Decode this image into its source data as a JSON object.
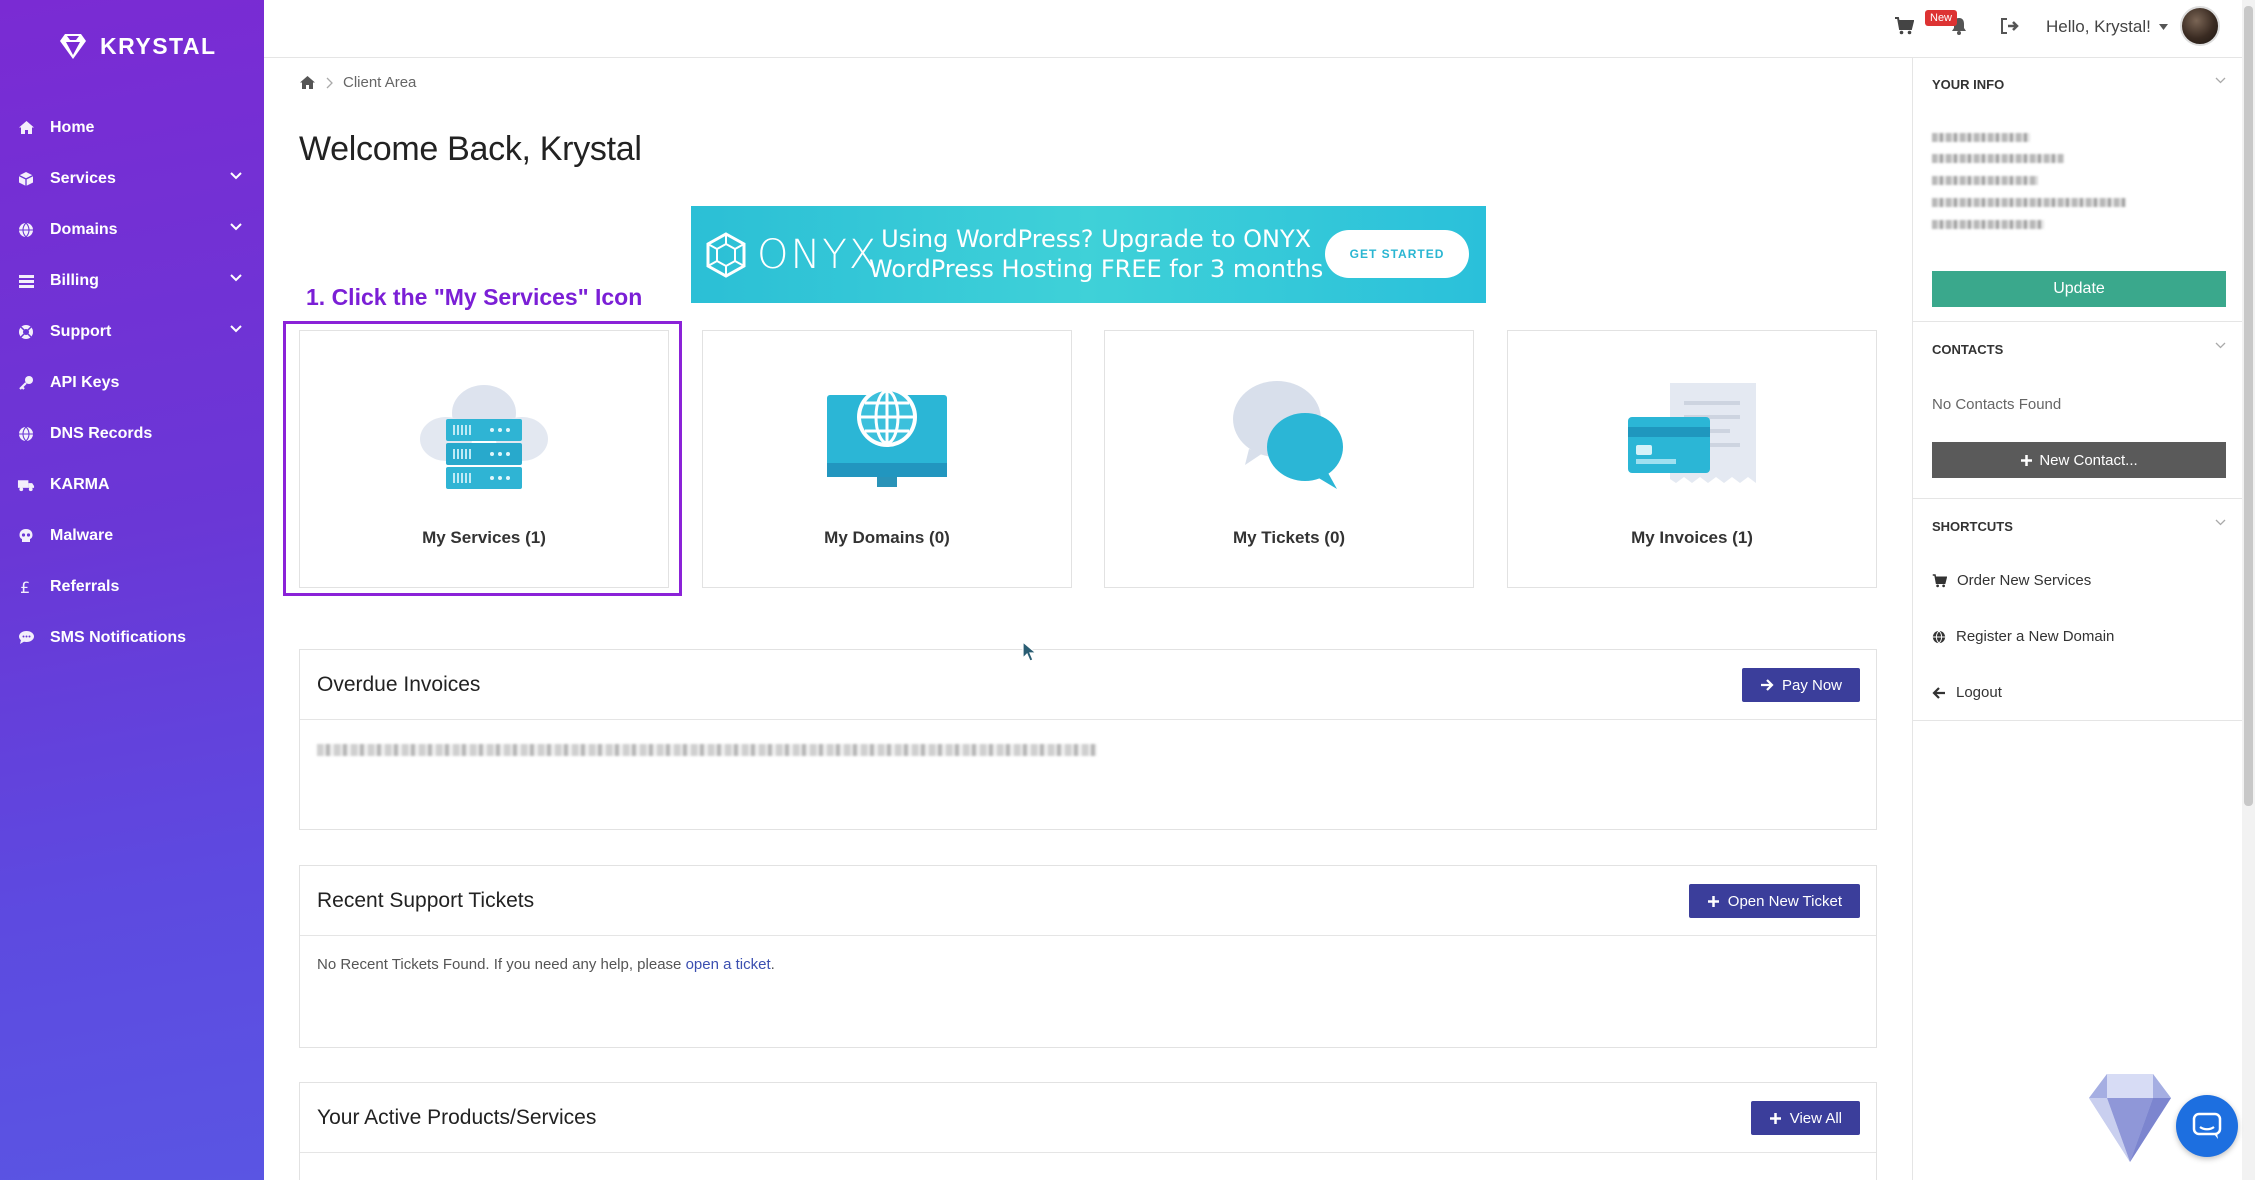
{
  "brand": {
    "name": "KRYSTAL"
  },
  "sidebar": {
    "items": [
      {
        "label": "Home",
        "icon": "home-icon",
        "has_children": false
      },
      {
        "label": "Services",
        "icon": "box-icon",
        "has_children": true
      },
      {
        "label": "Domains",
        "icon": "globe-icon",
        "has_children": true
      },
      {
        "label": "Billing",
        "icon": "billing-icon",
        "has_children": true
      },
      {
        "label": "Support",
        "icon": "lifebuoy-icon",
        "has_children": true
      },
      {
        "label": "API Keys",
        "icon": "key-icon",
        "has_children": false
      },
      {
        "label": "DNS Records",
        "icon": "globe-icon",
        "has_children": false
      },
      {
        "label": "KARMA",
        "icon": "truck-icon",
        "has_children": false
      },
      {
        "label": "Malware",
        "icon": "skull-icon",
        "has_children": false
      },
      {
        "label": "Referrals",
        "icon": "pound-icon",
        "has_children": false
      },
      {
        "label": "SMS Notifications",
        "icon": "comment-icon",
        "has_children": false
      }
    ]
  },
  "topbar": {
    "new_badge": "New",
    "greeting": "Hello, Krystal!"
  },
  "breadcrumb": {
    "current": "Client Area"
  },
  "page": {
    "title": "Welcome Back, Krystal"
  },
  "banner": {
    "brand": "ONYX",
    "line1": "Using WordPress? Upgrade to ONYX",
    "line2": "WordPress Hosting FREE for 3 months",
    "cta": "GET STARTED"
  },
  "annotation": "1. Click the \"My Services\" Icon",
  "tiles": [
    {
      "label": "My Services (1)"
    },
    {
      "label": "My Domains (0)"
    },
    {
      "label": "My Tickets (0)"
    },
    {
      "label": "My Invoices (1)"
    }
  ],
  "panels": {
    "overdue": {
      "title": "Overdue Invoices",
      "button": "Pay Now"
    },
    "tickets": {
      "title": "Recent Support Tickets",
      "button": "Open New Ticket",
      "text": "No Recent Tickets Found. If you need any help, please ",
      "link": "open a ticket",
      "suffix": "."
    },
    "products": {
      "title": "Your Active Products/Services",
      "button": "View All"
    }
  },
  "right_sidebar": {
    "your_info": {
      "title": "YOUR INFO",
      "button": "Update"
    },
    "contacts": {
      "title": "CONTACTS",
      "empty": "No Contacts Found",
      "button": "New Contact..."
    },
    "shortcuts": {
      "title": "SHORTCUTS",
      "items": [
        {
          "label": "Order New Services",
          "icon": "cart-icon"
        },
        {
          "label": "Register a New Domain",
          "icon": "globe-icon"
        },
        {
          "label": "Logout",
          "icon": "arrow-left-icon"
        }
      ]
    }
  },
  "colors": {
    "sidebar_top": "#7a2bd3",
    "sidebar_bottom": "#5a55e3",
    "primary_button": "#3b3e9b",
    "update_button": "#3aa88c",
    "highlight": "#8b22d8",
    "banner": "#2bbfd6"
  }
}
